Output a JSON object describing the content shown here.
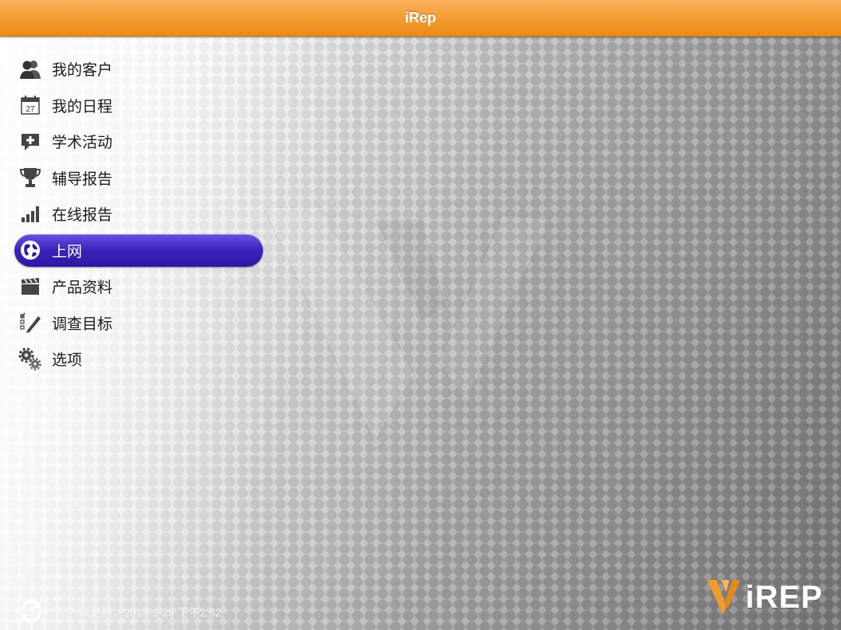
{
  "app": {
    "title": "iRep"
  },
  "menu": {
    "items": [
      {
        "label": "我的客户",
        "icon": "people-icon"
      },
      {
        "label": "我的日程",
        "icon": "calendar-icon",
        "icon_text": "27"
      },
      {
        "label": "学术活动",
        "icon": "speech-plus-icon"
      },
      {
        "label": "辅导报告",
        "icon": "trophy-icon"
      },
      {
        "label": "在线报告",
        "icon": "bar-chart-icon"
      },
      {
        "label": "上网",
        "icon": "globe-icon",
        "selected": true
      },
      {
        "label": "产品资料",
        "icon": "clapperboard-icon"
      },
      {
        "label": "调查目标",
        "icon": "checklist-pencil-icon"
      },
      {
        "label": "选项",
        "icon": "gears-icon"
      }
    ]
  },
  "footer": {
    "last_update": "上一次更新：2013-9-29 下午2:52",
    "icon": "sync-icon"
  },
  "brand": {
    "text": "iREP",
    "accent_color": "#f39a2c"
  },
  "colors": {
    "titlebar": "#f39a2c",
    "selected": "#3a23b9"
  }
}
